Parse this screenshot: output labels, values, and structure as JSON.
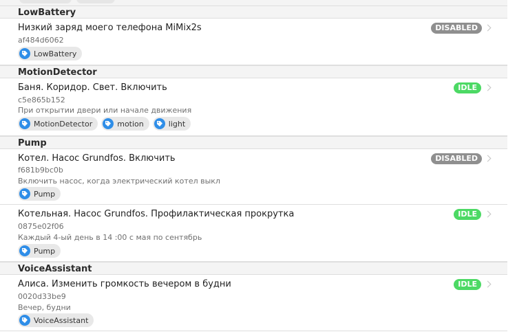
{
  "groups": [
    {
      "name": "LowBattery",
      "items": [
        {
          "title": "Низкий заряд моего телефона MiMix2s",
          "id": "af484d6062",
          "description": "",
          "status": "DISABLED",
          "tags": [
            "LowBattery"
          ]
        }
      ]
    },
    {
      "name": "MotionDetector",
      "items": [
        {
          "title": "Баня. Коридор. Свет. Включить",
          "id": "c5e865b152",
          "description": "При открытии двери или начале движения",
          "status": "IDLE",
          "tags": [
            "MotionDetector",
            "motion",
            "light"
          ]
        }
      ]
    },
    {
      "name": "Pump",
      "items": [
        {
          "title": "Котел. Насос Grundfos. Включить",
          "id": "f681b9bc0b",
          "description": "Включить насос, когда электрический котел выкл",
          "status": "DISABLED",
          "tags": [
            "Pump"
          ]
        },
        {
          "title": "Котельная. Насос Grundfos. Профилактическая прокрутка",
          "id": "0875e02f06",
          "description": "Каждый 4-ый день в 14 :00 с мая по сентябрь",
          "status": "IDLE",
          "tags": [
            "Pump"
          ]
        }
      ]
    },
    {
      "name": "VoiceAssistant",
      "items": [
        {
          "title": "Алиса. Изменить громкость вечером в будни",
          "id": "0020d33be9",
          "description": "Вечер, будни",
          "status": "IDLE",
          "tags": [
            "VoiceAssistant"
          ]
        }
      ]
    }
  ],
  "colors": {
    "tag_icon": "#2f8ee8",
    "idle_badge": "#4cd964",
    "disabled_badge": "#8f8f8f",
    "group_header_bg": "#f4f4f4"
  }
}
